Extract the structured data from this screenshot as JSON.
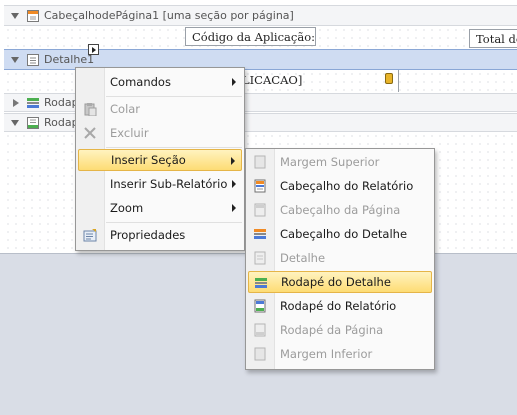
{
  "bands": {
    "page_header": {
      "label": "CabeçalhodePágina1 [uma seção por página]"
    },
    "detail": {
      "label": "Detalhe1"
    },
    "footer1": {
      "label": "Rodap"
    },
    "footer2": {
      "label": "Rodap"
    }
  },
  "fields": {
    "app_code_label": "Código da Aplicação:",
    "total_label": "Total de",
    "detail_field": "LICACAO]"
  },
  "context_menu": {
    "items": [
      {
        "label": "Comandos",
        "disabled": false,
        "submenu": true
      },
      {
        "label": "Colar",
        "disabled": true,
        "icon": "paste-icon"
      },
      {
        "label": "Excluir",
        "disabled": true,
        "icon": "delete-icon"
      },
      {
        "label": "Inserir Seção",
        "disabled": false,
        "submenu": true,
        "highlighted": true
      },
      {
        "label": "Inserir Sub-Relatório",
        "disabled": false,
        "submenu": true
      },
      {
        "label": "Zoom",
        "disabled": false,
        "submenu": true
      },
      {
        "label": "Propriedades",
        "disabled": false,
        "icon": "properties-icon"
      }
    ]
  },
  "submenu": {
    "items": [
      {
        "label": "Margem Superior",
        "disabled": true,
        "icon": "top-margin-icon"
      },
      {
        "label": "Cabeçalho do Relatório",
        "disabled": false,
        "icon": "report-header-icon"
      },
      {
        "label": "Cabeçalho da Página",
        "disabled": true,
        "icon": "page-header-icon"
      },
      {
        "label": "Cabeçalho do Detalhe",
        "disabled": false,
        "icon": "detail-header-icon"
      },
      {
        "label": "Detalhe",
        "disabled": true,
        "icon": "detail-icon"
      },
      {
        "label": "Rodapé do Detalhe",
        "disabled": false,
        "highlighted": true,
        "icon": "detail-footer-icon"
      },
      {
        "label": "Rodapé do Relatório",
        "disabled": false,
        "icon": "report-footer-icon"
      },
      {
        "label": "Rodapé da Página",
        "disabled": true,
        "icon": "page-footer-icon"
      },
      {
        "label": "Margem Inferior",
        "disabled": true,
        "icon": "bottom-margin-icon"
      }
    ]
  },
  "colors": {
    "menu_highlight": "#fddc74",
    "band_selected": "#cfdcf2"
  }
}
